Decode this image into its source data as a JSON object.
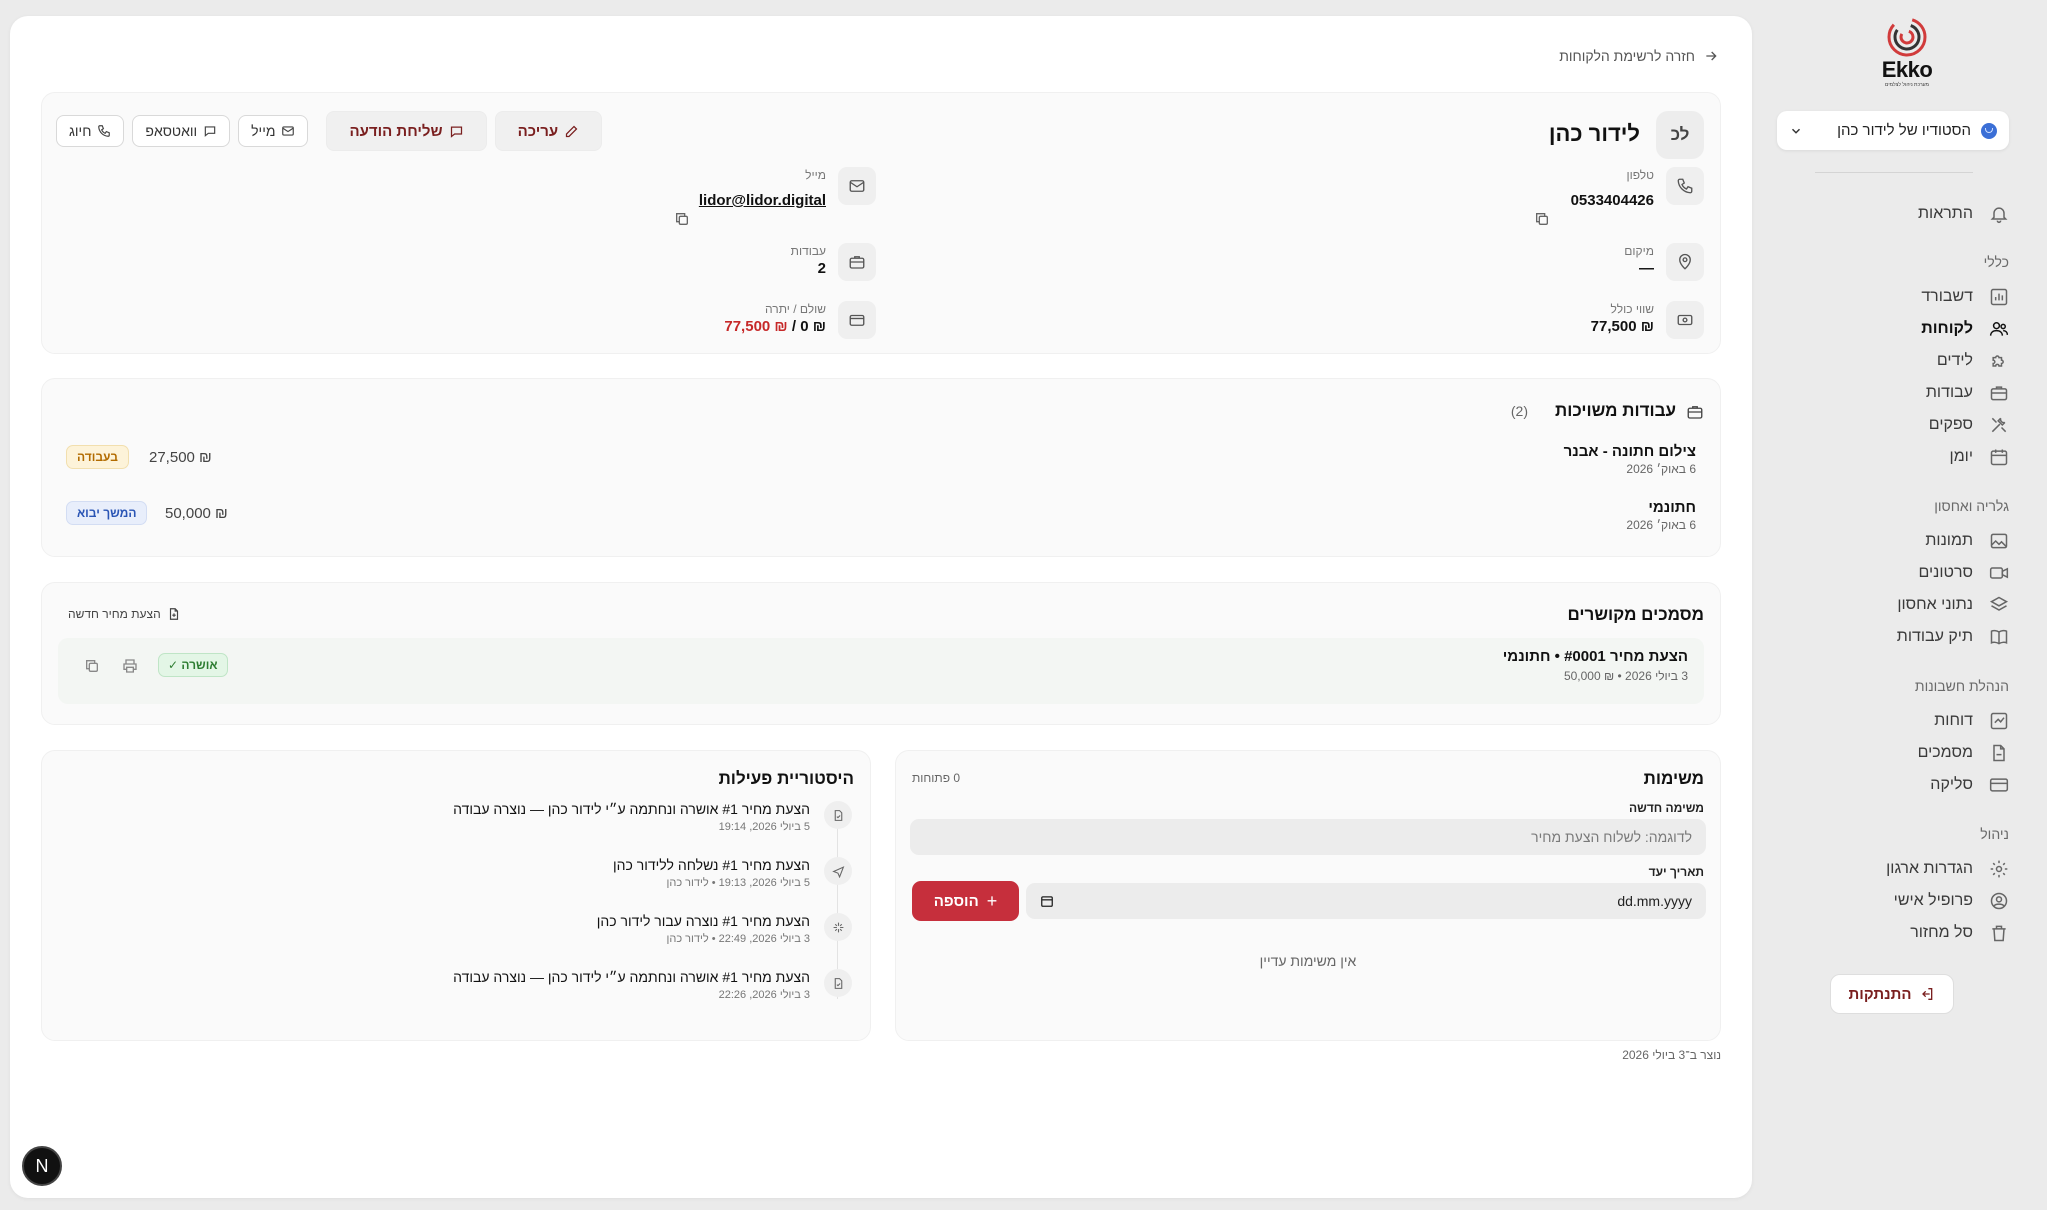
{
  "brand": {
    "name": "Ekko",
    "tagline": "מערכת ניהול לצלמים"
  },
  "sidebar": {
    "studio": "הסטודיו של לידור כהן",
    "notifications": "התראות",
    "sections": {
      "general": "כללי",
      "gallery": "גלריה ואחסון",
      "accounting": "הנהלת חשבונות",
      "management": "ניהול"
    },
    "items": {
      "dashboard": "דשבורד",
      "customers": "לקוחות",
      "leads": "לידים",
      "jobs": "עבודות",
      "suppliers": "ספקים",
      "calendar": "יומן",
      "photos": "תמונות",
      "videos": "סרטונים",
      "storage": "נתוני אחסון",
      "portfolio": "תיק עבודות",
      "reports": "דוחות",
      "documents": "מסמכים",
      "clearing": "סליקה",
      "org_settings": "הגדרות ארגון",
      "profile": "פרופיל אישי",
      "trash": "סל מחזור"
    },
    "logout": "התנתקות"
  },
  "main": {
    "back": "חזרה לרשימת הלקוחות",
    "customer": {
      "initials": "לכ",
      "name": "לידור כהן",
      "actions": {
        "call": "חיוג",
        "whatsapp": "וואטסאפ",
        "mail": "מייל",
        "send_message": "שליחת הודעה",
        "edit": "עריכה"
      },
      "phone_label": "טלפון",
      "phone": "0533404426",
      "email_label": "מייל",
      "email": "lidor@lidor.digital",
      "location_label": "מיקום",
      "location": "—",
      "jobs_label": "עבודות",
      "jobs_count": "2",
      "total_label": "שווי כולל",
      "total": "₪ 77,500",
      "paid_label": "שולם / יתרה",
      "paid": "₪ 0 /",
      "balance": "₪ 77,500"
    },
    "jobs": {
      "title": "עבודות משויכות",
      "count": "(2)",
      "items": [
        {
          "name": "צילום חתונה - אבנר",
          "date": "6 באוק׳ 2026",
          "price": "₪ 27,500",
          "status": "בעבודה"
        },
        {
          "name": "חתונמי",
          "date": "6 באוק׳ 2026",
          "price": "₪ 50,000",
          "status": "המשך יבוא"
        }
      ]
    },
    "documents": {
      "title": "מסמכים מקושרים",
      "new_quote": "הצעת מחיר חדשה",
      "items": [
        {
          "name": "הצעת מחיר #0001 • חתונמי",
          "meta": "3 ביולי 2026 • ₪ 50,000",
          "status": "אושרה ✓"
        }
      ]
    },
    "tasks": {
      "title": "משימות",
      "open_count": "0 פתוחות",
      "new_label": "משימה חדשה",
      "new_placeholder": "לדוגמה: לשלוח הצעת מחיר",
      "due_label": "תאריך יעד",
      "due_placeholder": "dd.mm.yyyy",
      "add": "הוספה",
      "empty": "אין משימות עדיין"
    },
    "history": {
      "title": "היסטוריית פעילות",
      "items": [
        {
          "icon": "document-check-icon",
          "title": "הצעת מחיר #1 אושרה ונחתמה ע״י לידור כהן — נוצרה עבודה",
          "meta": "5 ביולי 2026, 19:14"
        },
        {
          "icon": "send-icon",
          "title": "הצעת מחיר #1 נשלחה ללידור כהן",
          "meta": "5 ביולי 2026, 19:13 • לידור כהן"
        },
        {
          "icon": "sparkle-icon",
          "title": "הצעת מחיר #1 נוצרה עבור לידור כהן",
          "meta": "3 ביולי 2026, 22:49 • לידור כהן"
        },
        {
          "icon": "document-check-icon",
          "title": "הצעת מחיר #1 אושרה ונחתמה ע״י לידור כהן — נוצרה עבודה",
          "meta": "3 ביולי 2026, 22:26"
        }
      ]
    },
    "created": "נוצר ב־3 ביולי 2026"
  },
  "fab_label": "N"
}
